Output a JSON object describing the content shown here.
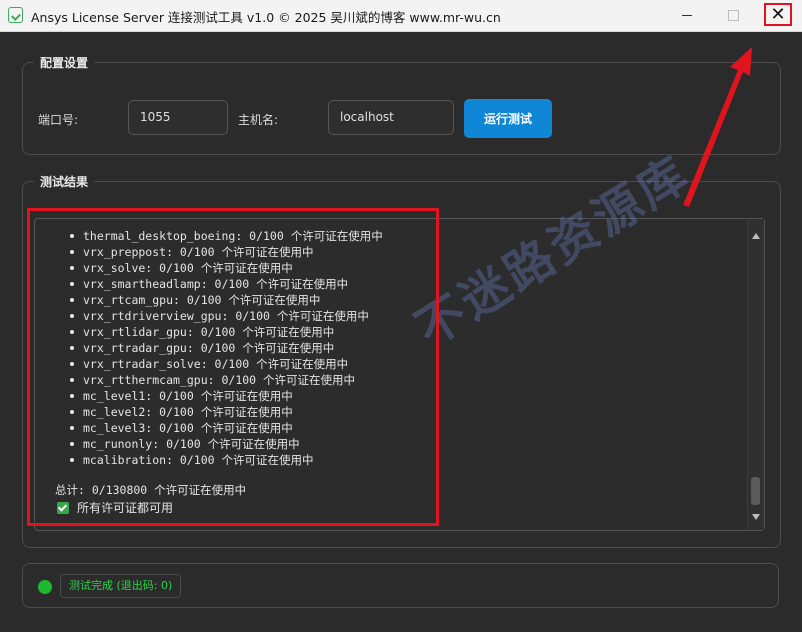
{
  "window": {
    "title": "Ansys License Server 连接测试工具 v1.0 © 2025 吴川斌的博客 www.mr-wu.cn",
    "close_glyph": "✕"
  },
  "config": {
    "group_title": "配置设置",
    "port_label": "端口号:",
    "port_value": "1055",
    "host_label": "主机名:",
    "host_value": "localhost",
    "run_button": "运行测试"
  },
  "results": {
    "group_title": "测试结果",
    "lines": [
      "thermal_desktop_boeing: 0/100 个许可证在使用中",
      "vrx_preppost: 0/100 个许可证在使用中",
      "vrx_solve: 0/100 个许可证在使用中",
      "vrx_smartheadlamp: 0/100 个许可证在使用中",
      "vrx_rtcam_gpu: 0/100 个许可证在使用中",
      "vrx_rtdriverview_gpu: 0/100 个许可证在使用中",
      "vrx_rtlidar_gpu: 0/100 个许可证在使用中",
      "vrx_rtradar_gpu: 0/100 个许可证在使用中",
      "vrx_rtradar_solve: 0/100 个许可证在使用中",
      "vrx_rtthermcam_gpu: 0/100 个许可证在使用中",
      "mc_level1: 0/100 个许可证在使用中",
      "mc_level2: 0/100 个许可证在使用中",
      "mc_level3: 0/100 个许可证在使用中",
      "mc_runonly: 0/100 个许可证在使用中",
      "mcalibration: 0/100 个许可证在使用中"
    ],
    "summary": "总计: 0/130800 个许可证在使用中",
    "all_available": "所有许可证都可用"
  },
  "status": {
    "text": "测试完成 (退出码: 0)",
    "color": "#1fb82f"
  },
  "watermark": {
    "text": "不迷路资源库"
  },
  "annotation": {
    "color": "#e0141e"
  }
}
